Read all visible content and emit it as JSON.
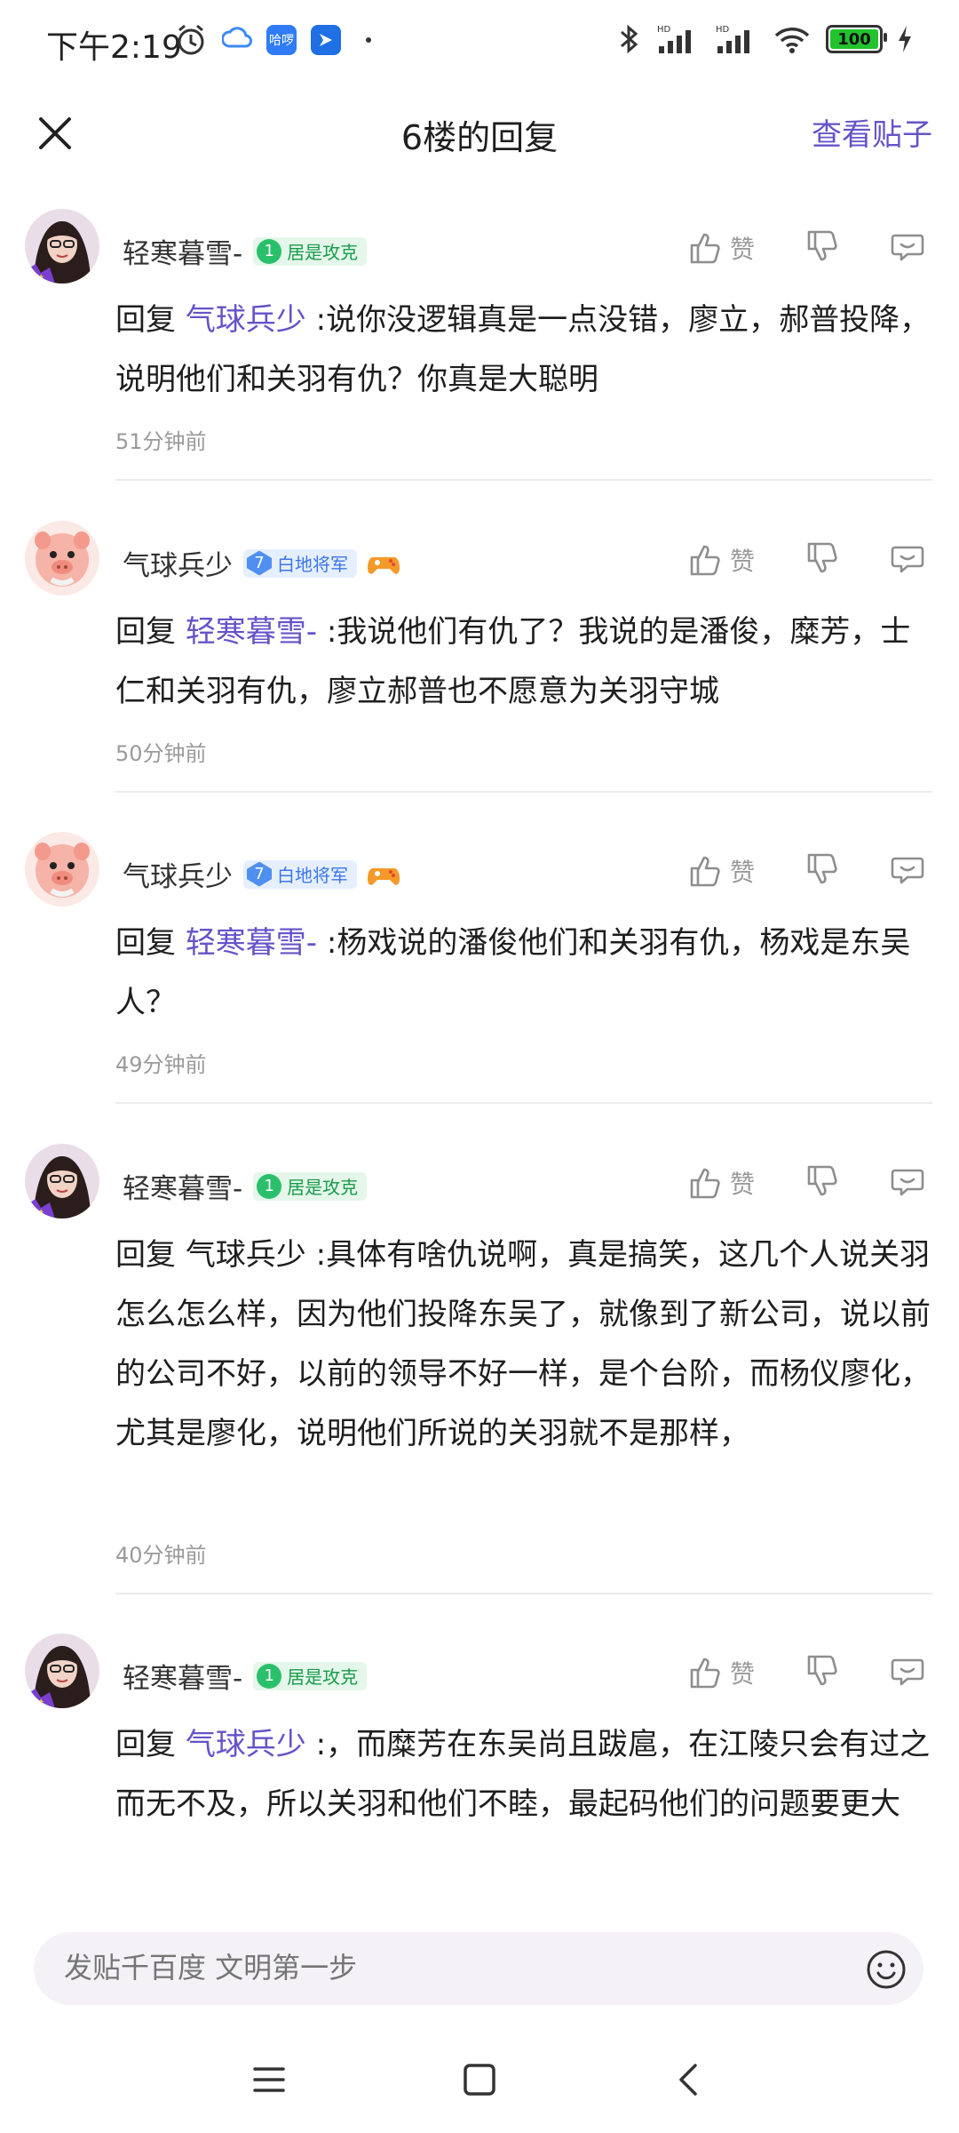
{
  "status_bar": {
    "time": "下午2:19",
    "battery": "100",
    "app_badge": "哈啰"
  },
  "header": {
    "title": "6楼的回复",
    "view_post": "查看贴子"
  },
  "like_label": "赞",
  "comments": [
    {
      "username": "轻寒暮雪-",
      "level": "1",
      "rank": "居是攻克",
      "badge_style": "green",
      "reply_prefix": "回复",
      "mention": "气球兵少",
      "mention_colored": true,
      "text": ":说你没逻辑真是一点没错，廖立，郝普投降，说明他们和关羽有仇？你真是大聪明",
      "time": "51分钟前"
    },
    {
      "username": "气球兵少",
      "level": "7",
      "rank": "白地将军",
      "badge_style": "blue",
      "reply_prefix": "回复",
      "mention": "轻寒暮雪-",
      "mention_colored": true,
      "text": ":我说他们有仇了？我说的是潘俊，糜芳，士仁和关羽有仇，廖立郝普也不愿意为关羽守城",
      "time": "50分钟前"
    },
    {
      "username": "气球兵少",
      "level": "7",
      "rank": "白地将军",
      "badge_style": "blue",
      "reply_prefix": "回复",
      "mention": "轻寒暮雪-",
      "mention_colored": true,
      "text": ":杨戏说的潘俊他们和关羽有仇，杨戏是东吴人？",
      "time": "49分钟前"
    },
    {
      "username": "轻寒暮雪-",
      "level": "1",
      "rank": "居是攻克",
      "badge_style": "green",
      "reply_prefix": "回复",
      "mention": "气球兵少",
      "mention_colored": false,
      "text": ":具体有啥仇说啊，真是搞笑，这几个人说关羽怎么怎么样，因为他们投降东吴了，就像到了新公司，说以前的公司不好，以前的领导不好一样，是个台阶，而杨仪廖化，尤其是廖化，说明他们所说的关羽就不是那样，",
      "time": "40分钟前"
    },
    {
      "username": "轻寒暮雪-",
      "level": "1",
      "rank": "居是攻克",
      "badge_style": "green",
      "reply_prefix": "回复",
      "mention": "气球兵少",
      "mention_colored": true,
      "text": ":，而糜芳在东吴尚且跋扈，在江陵只会有过之而无不及，所以关羽和他们不睦，最起码他们的问题要更大",
      "time": ""
    }
  ],
  "input": {
    "placeholder": "发贴千百度 文明第一步"
  },
  "colors": {
    "accent": "#6553c8",
    "muted": "#9a9a9a"
  }
}
